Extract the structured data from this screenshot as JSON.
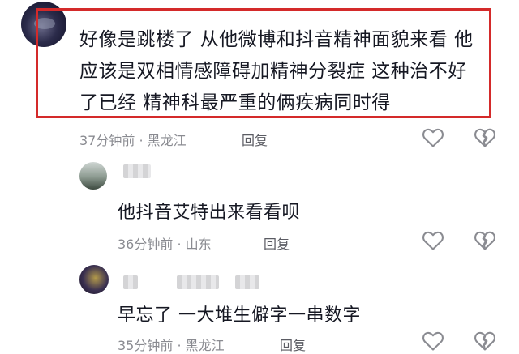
{
  "comment": {
    "lines": [
      "好像是跳楼了 从他微博和抖音精神面貌来看 他",
      "应该是双相情感障碍加精神分裂症  这种治不好",
      "了已经 精神科最严重的俩疾病同时得"
    ],
    "meta": "37分钟前 · 黑龙江",
    "reply_label": "回复"
  },
  "replies": [
    {
      "text": "他抖音艾特出来看看呗",
      "meta": "36分钟前 · 山东",
      "reply_label": "回复"
    },
    {
      "text": "早忘了 一大堆生僻字一串数字",
      "meta": "35分钟前 · 黑龙江",
      "reply_label": "回复"
    }
  ],
  "colors": {
    "highlight_border": "#d42a2a",
    "meta_text": "#8a8b91",
    "body_text": "#161823"
  },
  "icons": [
    "heart-icon",
    "broken-heart-icon"
  ]
}
